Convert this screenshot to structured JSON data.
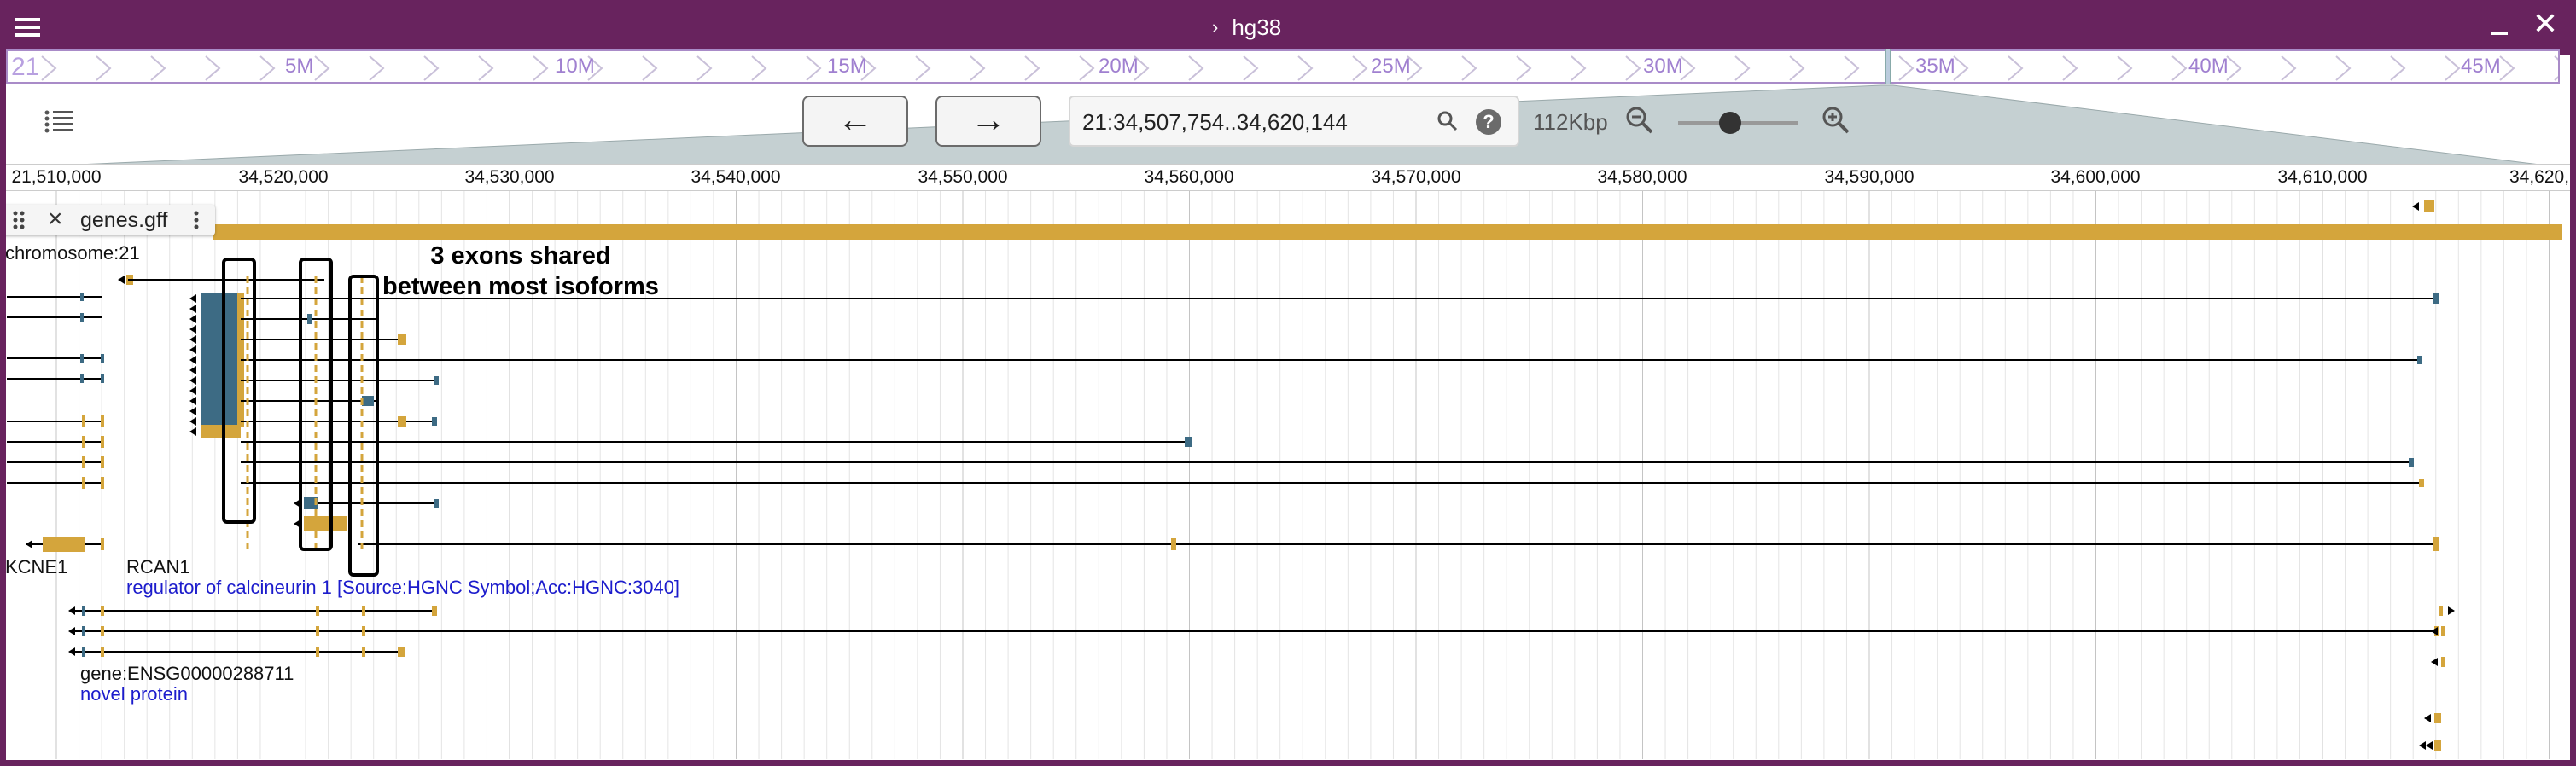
{
  "titlebar": {
    "assembly": "hg38",
    "chevron": "›",
    "close_glyph": "✕"
  },
  "overview": {
    "chromosome": "21",
    "labels": [
      "5M",
      "10M",
      "15M",
      "20M",
      "25M",
      "30M",
      "35M",
      "40M",
      "45M"
    ]
  },
  "nav": {
    "back_glyph": "←",
    "forward_glyph": "→",
    "location": "21:34,507,754..34,620,144",
    "help_glyph": "?",
    "bp_size": "112Kbp"
  },
  "ruler": {
    "first_label": "21,510,000",
    "labels": [
      "34,520,000",
      "34,530,000",
      "34,540,000",
      "34,550,000",
      "34,560,000",
      "34,570,000",
      "34,580,000",
      "34,590,000",
      "34,600,000",
      "34,610,000",
      "34,620,"
    ]
  },
  "track": {
    "name": "genes.gff"
  },
  "features": {
    "chromosome_label": "chromosome:21",
    "genes": [
      {
        "name": "KCNE1",
        "description": ""
      },
      {
        "name": "RCAN1",
        "description": "regulator of calcineurin 1 [Source:HGNC Symbol;Acc:HGNC:3040]"
      },
      {
        "name": "gene:ENSG00000288711",
        "description": "novel protein"
      }
    ]
  },
  "annotation": {
    "line1": "3 exons shared",
    "line2": "between most isoforms"
  },
  "colors": {
    "titlebar": "#68235e",
    "gene": "#d4a53c",
    "cds": "#3d6b84",
    "overview_text": "#a080d0",
    "desc_text": "#1c1ccc"
  },
  "icons": [
    "menu-icon",
    "minimize-icon",
    "close-icon",
    "track-list-icon",
    "search-icon",
    "help-icon",
    "zoom-out-icon",
    "zoom-in-icon",
    "drag-handle-icon",
    "track-menu-icon"
  ]
}
